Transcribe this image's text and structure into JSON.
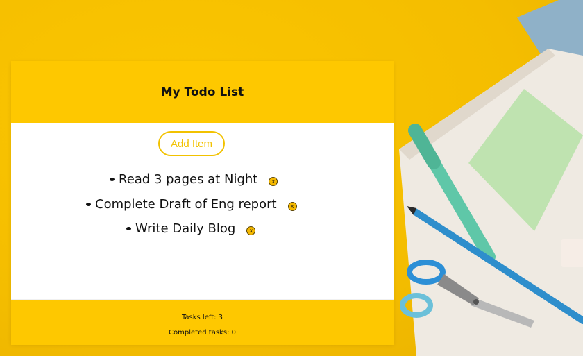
{
  "app": {
    "title": "My Todo List",
    "add_button_label": "Add Item"
  },
  "todos": [
    {
      "text": "Read 3 pages at Night",
      "delete_label": "x"
    },
    {
      "text": "Complete Draft of Eng report",
      "delete_label": "x"
    },
    {
      "text": "Write Daily Blog",
      "delete_label": "x"
    }
  ],
  "footer": {
    "tasks_left": "Tasks left: 3",
    "completed_tasks": "Completed tasks: 0"
  },
  "colors": {
    "accent": "#fec800",
    "background": "#f4bd00"
  }
}
